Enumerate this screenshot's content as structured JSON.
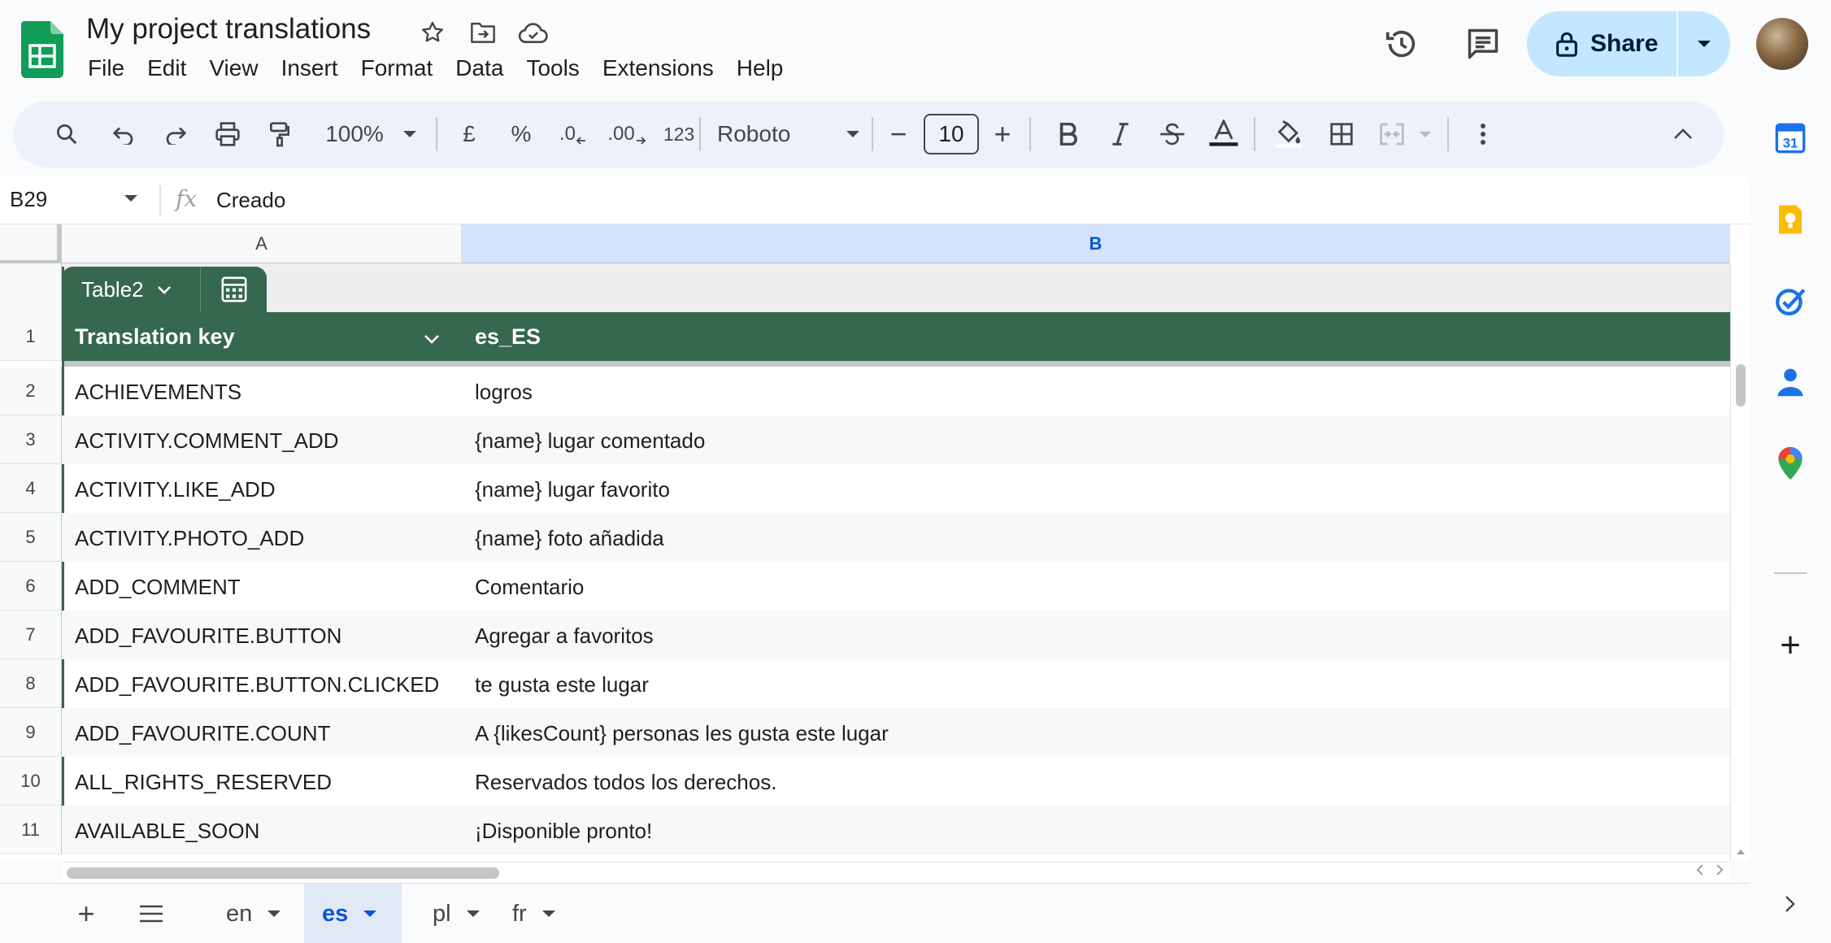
{
  "app": {
    "document_title": "My project translations",
    "menu": [
      "File",
      "Edit",
      "View",
      "Insert",
      "Format",
      "Data",
      "Tools",
      "Extensions",
      "Help"
    ],
    "share_label": "Share"
  },
  "toolbar": {
    "zoom": "100%",
    "currency": "£",
    "percent": "%",
    "decrease_decimal": ".0",
    "increase_decimal": ".00",
    "number_format": "123",
    "font": "Roboto",
    "font_size": "10",
    "minus": "−",
    "plus": "+"
  },
  "formula_bar": {
    "cell_ref": "B29",
    "fx": "fx",
    "content": "Creado"
  },
  "grid": {
    "columns": [
      "A",
      "B"
    ],
    "selected_column": "B",
    "table_name": "Table2",
    "header_row_number": "1",
    "headers": [
      "Translation key",
      "es_ES"
    ],
    "rows": [
      {
        "n": "2",
        "key": "ACHIEVEMENTS",
        "value": "logros"
      },
      {
        "n": "3",
        "key": "ACTIVITY.COMMENT_ADD",
        "value": "{name} lugar comentado"
      },
      {
        "n": "4",
        "key": "ACTIVITY.LIKE_ADD",
        "value": "{name} lugar favorito"
      },
      {
        "n": "5",
        "key": "ACTIVITY.PHOTO_ADD",
        "value": "{name} foto añadida"
      },
      {
        "n": "6",
        "key": "ADD_COMMENT",
        "value": "Comentario"
      },
      {
        "n": "7",
        "key": "ADD_FAVOURITE.BUTTON",
        "value": "Agregar a favoritos"
      },
      {
        "n": "8",
        "key": "ADD_FAVOURITE.BUTTON.CLICKED",
        "value": "te gusta este lugar"
      },
      {
        "n": "9",
        "key": "ADD_FAVOURITE.COUNT",
        "value": "A {likesCount} personas les gusta este lugar"
      },
      {
        "n": "10",
        "key": "ALL_RIGHTS_RESERVED",
        "value": "Reservados todos los derechos."
      },
      {
        "n": "11",
        "key": "AVAILABLE_SOON",
        "value": "¡Disponible pronto!"
      }
    ]
  },
  "sheets": {
    "tabs": [
      "en",
      "es",
      "pl",
      "fr"
    ],
    "active": "es",
    "add": "+"
  },
  "side_panel": {
    "calendar_day": "31",
    "add": "+"
  },
  "colors": {
    "table_green": "#36674f",
    "share_bg": "#c2e7ff",
    "selected_col": "#d3e3fd",
    "active_tab_text": "#0b57d0"
  }
}
